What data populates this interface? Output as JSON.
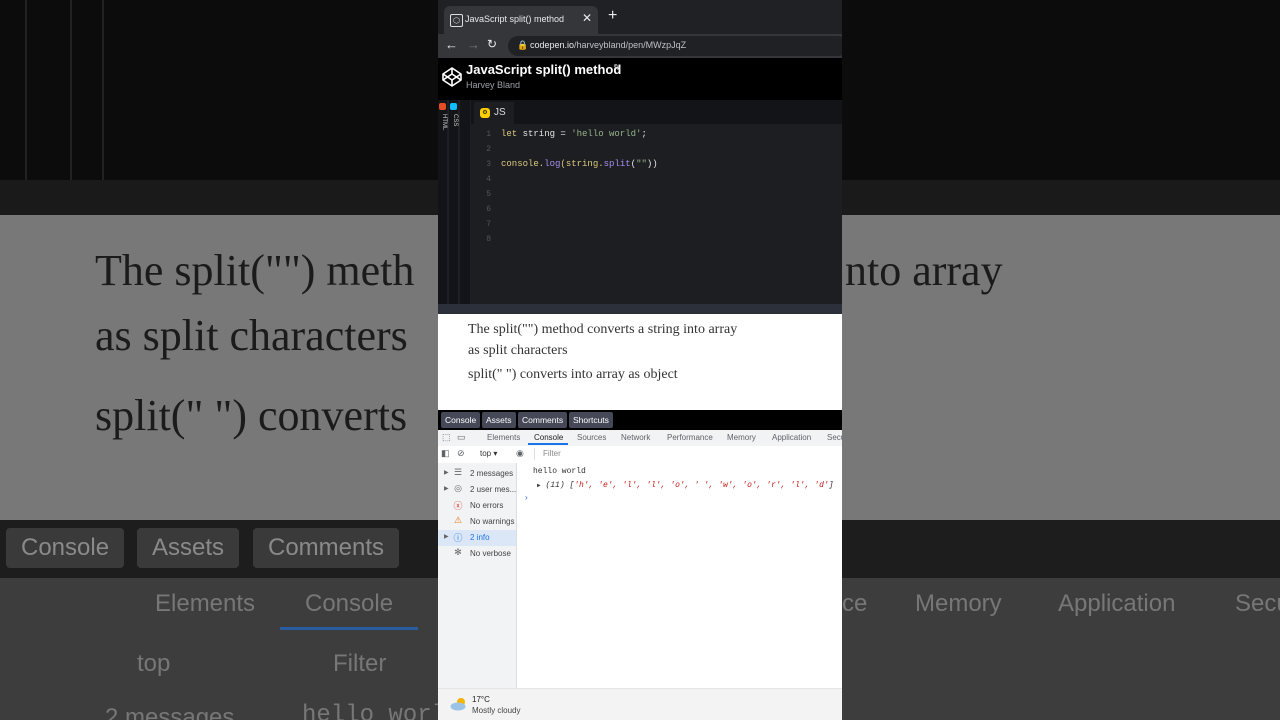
{
  "browser": {
    "tab_title": "JavaScript split() method",
    "url_host": "codepen.io",
    "url_path": "/harveybland/pen/MWzpJqZ"
  },
  "codepen": {
    "title": "JavaScript split() method",
    "author": "Harvey Bland",
    "rail_labels": [
      "HTML",
      "CSS"
    ],
    "editor_tab": "JS",
    "line_numbers": [
      "1",
      "2",
      "3",
      "4",
      "5",
      "6",
      "7",
      "8"
    ],
    "code": {
      "l1_kw": "let",
      "l1_rest": " string = ",
      "l1_str": "'hello world'",
      "l1_end": ";",
      "l3_a": "console.",
      "l3_fn": "log",
      "l3_b": "(string.",
      "l3_fn2": "split",
      "l3_c": "(",
      "l3_str": "\"\"",
      "l3_d": "))"
    },
    "bottom_tabs": [
      "Console",
      "Assets",
      "Comments",
      "Shortcuts"
    ]
  },
  "preview": {
    "line1": "The split(\"\") method converts a string into array",
    "line2": "as split characters",
    "line3": "split(\" \") converts into array as object"
  },
  "devtools": {
    "tabs": [
      "Elements",
      "Console",
      "Sources",
      "Network",
      "Performance",
      "Memory",
      "Application",
      "Secu"
    ],
    "context": "top",
    "filter_placeholder": "Filter",
    "sidebar": [
      "2 messages",
      "2 user mes...",
      "No errors",
      "No warnings",
      "2 info",
      "No verbose"
    ],
    "output_1": "hello world",
    "output_2_count": "(11)",
    "output_2_open": " [",
    "output_2_items": "'h', 'e', 'l', 'l', 'o', ' ', 'w', 'o', 'r', 'l', 'd'",
    "output_2_close": "]"
  },
  "taskbar": {
    "temperature": "17°C",
    "condition": "Mostly cloudy"
  },
  "background": {
    "line1_left": "The split(\"\") meth",
    "line1_right": "nto array",
    "line2": "as split characters",
    "line3": "split(\" \") converts",
    "tabs": [
      "Console",
      "Assets",
      "Comments"
    ],
    "dev_tabs_left": [
      "Elements",
      "Console"
    ],
    "dev_tabs_right": [
      "ce",
      "Memory",
      "Application",
      "Secu"
    ],
    "context": "top",
    "filter": "Filter",
    "bottom_left": "2 messages",
    "bottom_right": "hello worl"
  },
  "colors": {
    "js_icon": "#fcd000",
    "html_rail": "#e44d26",
    "css_rail": "#0ebeff",
    "devtools_accent": "#1a73e8"
  }
}
